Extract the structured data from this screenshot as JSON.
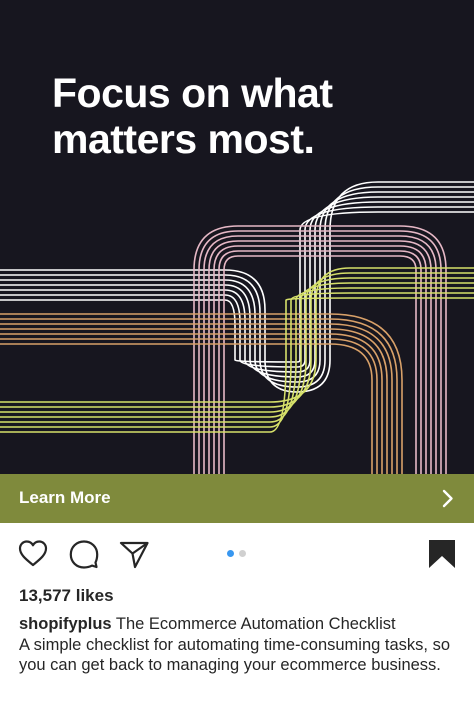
{
  "ad": {
    "headline": "Focus on what matters most.",
    "background_color": "#17161f",
    "line_colors": [
      "#ffffff",
      "#e6b8c6",
      "#d9a169",
      "#d6e06a"
    ]
  },
  "cta": {
    "label": "Learn More",
    "background_color": "#7f8a3c",
    "icon": "chevron-right-icon"
  },
  "actions": {
    "icons": [
      "heart-icon",
      "comment-icon",
      "share-icon",
      "bookmark-icon"
    ],
    "carousel": {
      "total": 2,
      "active": 1,
      "active_color": "#3897f0"
    }
  },
  "post": {
    "likes": "13,577 likes",
    "username": "shopifyplus",
    "caption_title": "The Ecommerce Automation Checklist",
    "caption_body": "A simple checklist for automating time-consuming tasks, so you can get back to managing your ecommerce business."
  }
}
